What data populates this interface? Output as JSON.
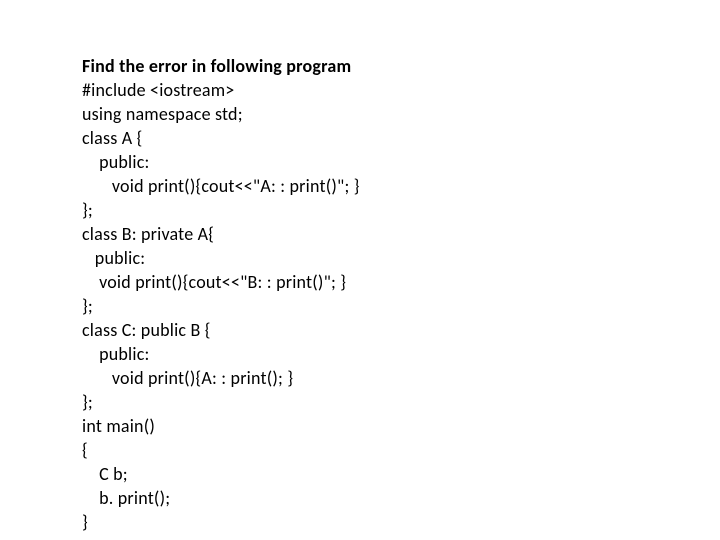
{
  "heading": "Find the error in following program",
  "code": "#include <iostream>\nusing namespace std;\nclass A {\n    public:\n       void print(){cout<<\"A: : print()\"; }\n};\nclass B: private A{\n   public:\n    void print(){cout<<\"B: : print()\"; }\n};\nclass C: public B {\n    public:\n       void print(){A: : print(); }\n};\nint main()\n{\n    C b;\n    b. print();\n}"
}
